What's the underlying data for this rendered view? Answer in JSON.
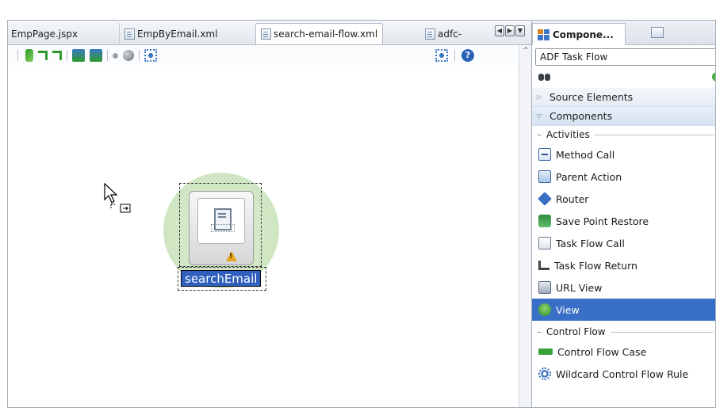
{
  "editor": {
    "tabs": [
      {
        "label": "EmpPage.jspx",
        "active": false
      },
      {
        "label": "EmpByEmail.xml",
        "active": false
      },
      {
        "label": "search-email-flow.xml",
        "active": true
      },
      {
        "label": "adfc-",
        "active": false
      }
    ],
    "nav": {
      "left": "◀",
      "right": "▶",
      "menu": "▼"
    },
    "toolbar": {
      "help": "?"
    },
    "scroll": {
      "up": "^"
    }
  },
  "canvas": {
    "activity": {
      "name": "searchEmail",
      "warning": "!"
    }
  },
  "palette": {
    "tabs": [
      {
        "label": "Compone..."
      }
    ],
    "library": "ADF Task Flow",
    "sections": {
      "source_elements": "Source Elements",
      "components": "Components"
    },
    "activities_group": "Activities",
    "activities": [
      {
        "label": "Method Call",
        "icon": "method-call-icon"
      },
      {
        "label": "Parent Action",
        "icon": "parent-action-icon"
      },
      {
        "label": "Router",
        "icon": "router-icon"
      },
      {
        "label": "Save Point Restore",
        "icon": "save-point-restore-icon"
      },
      {
        "label": "Task Flow Call",
        "icon": "task-flow-call-icon"
      },
      {
        "label": "Task Flow Return",
        "icon": "task-flow-return-icon"
      },
      {
        "label": "URL View",
        "icon": "url-view-icon"
      },
      {
        "label": "View",
        "icon": "view-icon",
        "selected": true
      }
    ],
    "control_flow_group": "Control Flow",
    "control_flow": [
      {
        "label": "Control Flow Case",
        "icon": "control-flow-case-icon"
      },
      {
        "label": "Wildcard Control Flow Rule",
        "icon": "wildcard-rule-icon"
      }
    ]
  },
  "colors": {
    "selection": "#3a6fc7",
    "halo": "#cfe6c2",
    "warning": "#e6a21b"
  }
}
